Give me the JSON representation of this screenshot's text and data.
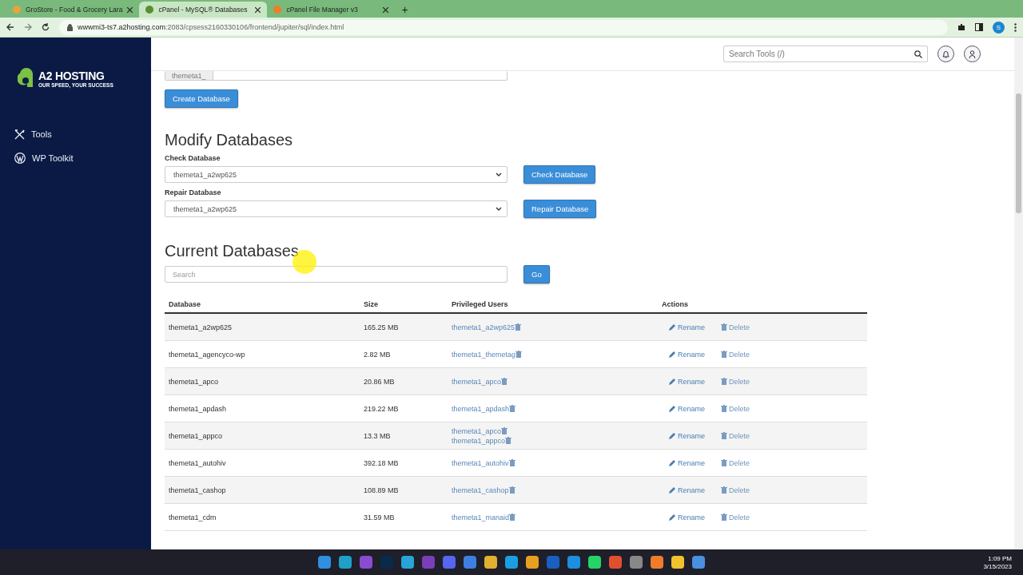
{
  "browser": {
    "tabs": [
      {
        "title": "GroStore - Food & Grocery Lara",
        "selected": false
      },
      {
        "title": "cPanel - MySQL® Databases",
        "selected": true
      },
      {
        "title": "cPanel File Manager v3",
        "selected": false
      }
    ],
    "new_tab": "+",
    "url_host": "wwwmi3-ts7.a2hosting.com",
    "url_rest": ":2083/cpsess2160330106/frontend/jupiter/sql/index.html",
    "profile": "S"
  },
  "sidebar": {
    "logo": {
      "name": "A2 HOSTING",
      "tagline": "OUR SPEED, YOUR SUCCESS"
    },
    "items": [
      {
        "kind": "tools",
        "label": "Tools"
      },
      {
        "kind": "wordpress",
        "label": "WP Toolkit"
      }
    ]
  },
  "header": {
    "search": {
      "placeholder": "Search Tools (/)"
    }
  },
  "create": {
    "prefix": "themeta1_",
    "button": "Create Database"
  },
  "modify": {
    "title": "Modify Databases",
    "check": {
      "label": "Check Database",
      "value": "themeta1_a2wp625",
      "button": "Check Database"
    },
    "repair": {
      "label": "Repair Database",
      "value": "themeta1_a2wp625",
      "button": "Repair Database"
    }
  },
  "current": {
    "title": "Current Databases",
    "search": {
      "placeholder": "Search"
    },
    "go": "Go",
    "columns": [
      "Database",
      "Size",
      "Privileged Users",
      "Actions"
    ],
    "rows": [
      {
        "database": "themeta1_a2wp625",
        "size": "165.25 MB",
        "users": [
          "themeta1_a2wp625"
        ],
        "rename": "Rename",
        "delete": "Delete"
      },
      {
        "database": "themeta1_agencyco-wp",
        "size": "2.82 MB",
        "users": [
          "themeta1_themetag"
        ],
        "rename": "Rename",
        "delete": "Delete"
      },
      {
        "database": "themeta1_apco",
        "size": "20.86 MB",
        "users": [
          "themeta1_apco"
        ],
        "rename": "Rename",
        "delete": "Delete"
      },
      {
        "database": "themeta1_apdash",
        "size": "219.22 MB",
        "users": [
          "themeta1_apdash"
        ],
        "rename": "Rename",
        "delete": "Delete"
      },
      {
        "database": "themeta1_appco",
        "size": "13.3 MB",
        "users": [
          "themeta1_apco",
          "themeta1_appco"
        ],
        "rename": "Rename",
        "delete": "Delete"
      },
      {
        "database": "themeta1_autohiv",
        "size": "392.18 MB",
        "users": [
          "themeta1_autohiv"
        ],
        "rename": "Rename",
        "delete": "Delete"
      },
      {
        "database": "themeta1_cashop",
        "size": "108.89 MB",
        "users": [
          "themeta1_cashop"
        ],
        "rename": "Rename",
        "delete": "Delete"
      },
      {
        "database": "themeta1_cdm",
        "size": "31.59 MB",
        "users": [
          "themeta1_manaid"
        ],
        "rename": "Rename",
        "delete": "Delete"
      }
    ]
  },
  "taskbar": {
    "apps": [
      {
        "color": "#2f8fe0"
      },
      {
        "color": "#1fa0c8"
      },
      {
        "color": "#8a4bd0"
      },
      {
        "color": "#0a2a4a"
      },
      {
        "color": "#27a5d8"
      },
      {
        "color": "#7a3fb8"
      },
      {
        "color": "#5865f2"
      },
      {
        "color": "#3f7fe0"
      },
      {
        "color": "#e0b030"
      },
      {
        "color": "#1aa0e0"
      },
      {
        "color": "#e8a020"
      },
      {
        "color": "#1a5fc0"
      },
      {
        "color": "#1d8fe0"
      },
      {
        "color": "#25d366"
      },
      {
        "color": "#e0502f"
      },
      {
        "color": "#888888"
      },
      {
        "color": "#f07c2b"
      },
      {
        "color": "#f2c12e"
      },
      {
        "color": "#4a8fe0"
      }
    ],
    "time": "1:09 PM",
    "date": "3/15/2023"
  }
}
